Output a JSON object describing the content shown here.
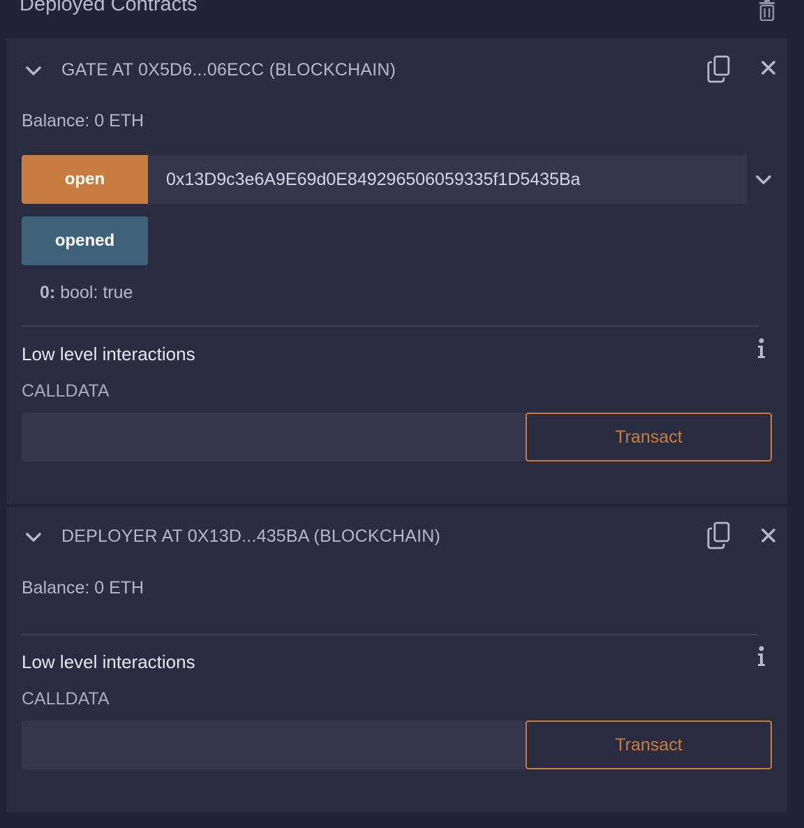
{
  "header": {
    "title": "Deployed Contracts"
  },
  "contracts": [
    {
      "title": "GATE AT 0X5D6...06ECC (BLOCKCHAIN)",
      "balance": "Balance: 0 ETH",
      "functions": [
        {
          "label": "open",
          "kind": "transact",
          "input_value": "0x13D9c3e6A9E69d0E849296506059335f1D5435Ba"
        },
        {
          "label": "opened",
          "kind": "call"
        }
      ],
      "result": {
        "key": "0:",
        "value": "bool: true"
      },
      "low_level": {
        "title": "Low level interactions",
        "calldata_label": "CALLDATA",
        "calldata_value": "",
        "transact_label": "Transact"
      }
    },
    {
      "title": "DEPLOYER AT 0X13D...435BA (BLOCKCHAIN)",
      "balance": "Balance: 0 ETH",
      "low_level": {
        "title": "Low level interactions",
        "calldata_label": "CALLDATA",
        "calldata_value": "",
        "transact_label": "Transact"
      }
    }
  ],
  "colors": {
    "background": "#222336",
    "card": "#2a2c3f",
    "transact_orange": "#c97c3f",
    "call_blue": "#3f6179",
    "input": "#35364b"
  },
  "icons": [
    "trash-icon",
    "chevron-down-icon",
    "copy-icon",
    "close-icon",
    "info-icon"
  ]
}
